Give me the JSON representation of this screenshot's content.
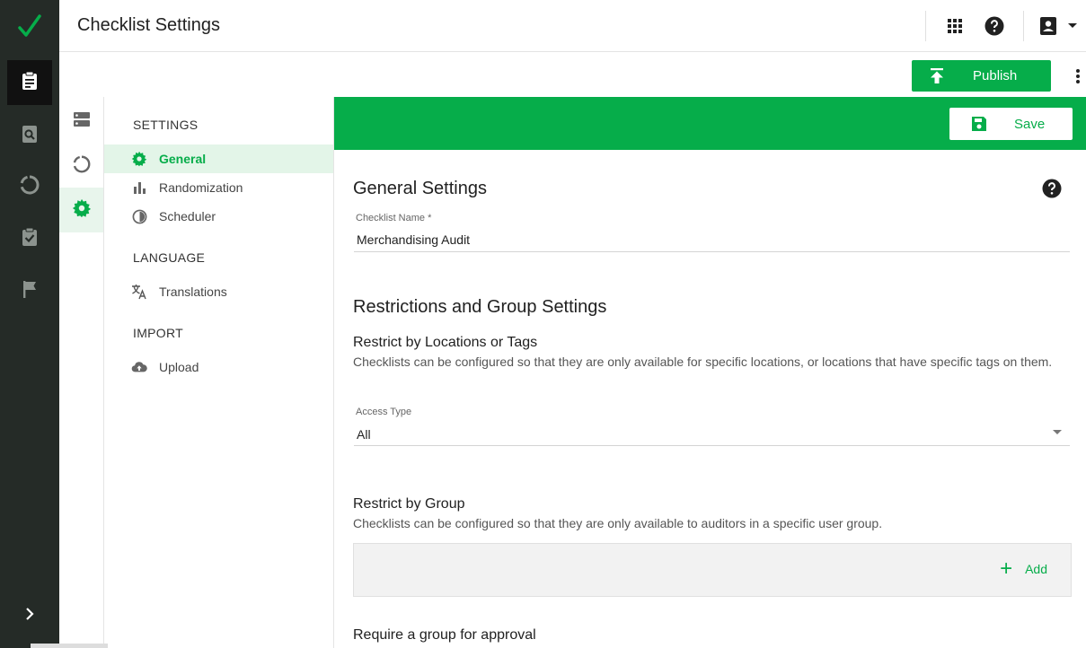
{
  "app": {
    "title": "Checklist Settings",
    "accent_color": "#06ad4a",
    "rail_color": "#252b27"
  },
  "rail": {
    "items": [
      {
        "icon": "checkmark-logo-icon"
      },
      {
        "icon": "clipboard-icon",
        "active": true
      },
      {
        "icon": "search-document-icon"
      },
      {
        "icon": "circle-progress-icon"
      },
      {
        "icon": "clipboard-check-icon"
      },
      {
        "icon": "flag-icon"
      }
    ],
    "expand_icon": "chevron-right-icon"
  },
  "topbar": {
    "icons": [
      "apps-grid-icon",
      "help-icon",
      "account-icon",
      "caret-down-icon"
    ]
  },
  "toolbar": {
    "publish_label": "Publish",
    "more_icon": "more-vertical-icon"
  },
  "subrail": {
    "items": [
      {
        "icon": "server-icon"
      },
      {
        "icon": "circle-progress-icon"
      },
      {
        "icon": "gear-icon",
        "active": true
      }
    ]
  },
  "nav": {
    "sections": [
      {
        "heading": "SETTINGS",
        "items": [
          {
            "label": "General",
            "icon": "gear-icon",
            "active": true
          },
          {
            "label": "Randomization",
            "icon": "bar-chart-icon"
          },
          {
            "label": "Scheduler",
            "icon": "timer-icon"
          }
        ]
      },
      {
        "heading": "LANGUAGE",
        "items": [
          {
            "label": "Translations",
            "icon": "translate-icon"
          }
        ]
      },
      {
        "heading": "IMPORT",
        "items": [
          {
            "label": "Upload",
            "icon": "cloud-upload-icon"
          }
        ]
      }
    ]
  },
  "main": {
    "save_label": "Save",
    "general": {
      "title": "General Settings",
      "name_label": "Checklist Name *",
      "name_value": "Merchandising Audit"
    },
    "restrictions": {
      "title": "Restrictions and Group Settings",
      "locations_title": "Restrict by Locations or Tags",
      "locations_desc": "Checklists can be configured so that they are only available for specific locations, or locations that have specific tags on them.",
      "access_label": "Access Type",
      "access_value": "All",
      "group_title": "Restrict by Group",
      "group_desc": "Checklists can be configured so that they are only available to auditors in a specific user group.",
      "add_label": "Add",
      "approval_title": "Require a group for approval"
    }
  }
}
